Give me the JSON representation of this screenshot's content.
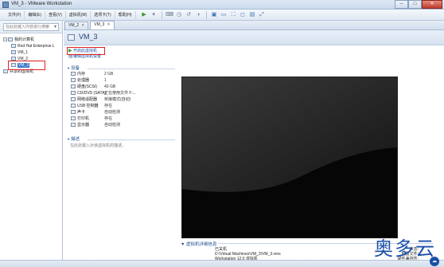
{
  "window": {
    "title": "VM_3 - VMware Workstation",
    "controls": [
      "–",
      "□",
      "✕"
    ]
  },
  "menu": {
    "items": [
      "文件(F)",
      "编辑(E)",
      "查看(V)",
      "虚拟机(M)",
      "选项卡(T)",
      "帮助(H)"
    ]
  },
  "toolbar": {
    "play_glyph": "▶",
    "dropdown_glyph": "▾"
  },
  "sidebar": {
    "search_placeholder": "在此处键入内容进行搜索",
    "tree": [
      {
        "label": "我的计算机",
        "level": 0,
        "expand": "−"
      },
      {
        "label": "Red Hat Enterprise L",
        "level": 1
      },
      {
        "label": "VM_1",
        "level": 1
      },
      {
        "label": "VM_2",
        "level": 1
      },
      {
        "label": "VM_3",
        "level": 1,
        "selected": true
      },
      {
        "label": "共享的虚拟机",
        "level": 0
      }
    ]
  },
  "tabs": [
    {
      "label": "VM_2",
      "close": "✕"
    },
    {
      "label": "VM_3",
      "close": "✕",
      "active": true
    }
  ],
  "vm": {
    "name": "VM_3",
    "actions": [
      "开启此虚拟机",
      "编辑虚拟机设置"
    ],
    "devices_title": "设备",
    "devices": [
      {
        "name": "内存",
        "value": "2 GB",
        "icon": "memory-icon"
      },
      {
        "name": "处理器",
        "value": "1",
        "icon": "cpu-icon"
      },
      {
        "name": "硬盘(SCSI)",
        "value": "40 GB",
        "icon": "hdd-icon"
      },
      {
        "name": "CD/DVD (SATA)",
        "value": "正在使用文件 F:...",
        "icon": "cdrom-icon"
      },
      {
        "name": "网络适配器",
        "value": "桥接模式(自动)",
        "icon": "network-icon"
      },
      {
        "name": "USB 控制器",
        "value": "存在",
        "icon": "usb-icon"
      },
      {
        "name": "声卡",
        "value": "自动检测",
        "icon": "sound-icon"
      },
      {
        "name": "打印机",
        "value": "存在",
        "icon": "printer-icon"
      },
      {
        "name": "显示器",
        "value": "自动检测",
        "icon": "display-icon"
      }
    ],
    "description_title": "描述",
    "description_hint": "在此处键入对该虚拟机的描述。",
    "details_title": "虚拟机详细信息",
    "details": [
      {
        "key": "状态:",
        "value": "已关机"
      },
      {
        "key": "配置文件:",
        "value": "D:\\Virtual Machines\\VM_3\\VM_3.vmx"
      },
      {
        "key": "硬件兼容性:",
        "value": "Workstation 12.0 虚拟机"
      }
    ]
  },
  "watermark": {
    "text": "奥多云",
    "badge": "☁"
  }
}
